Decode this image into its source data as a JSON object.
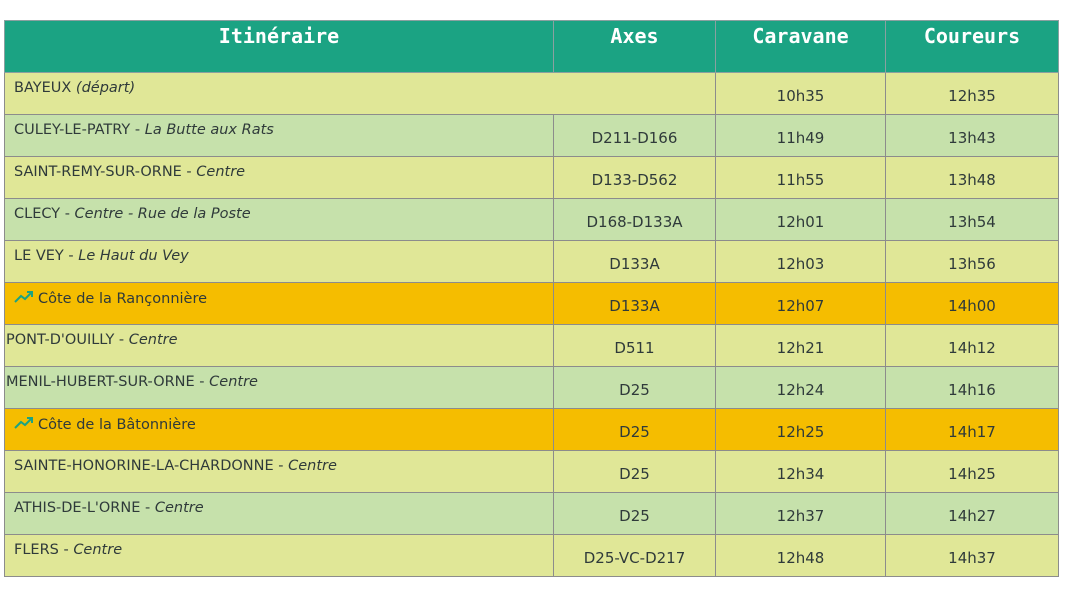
{
  "headers": {
    "itinerary": "Itinéraire",
    "axes": "Axes",
    "caravane": "Caravane",
    "coureurs": "Coureurs"
  },
  "colors": {
    "header": "#1ba383",
    "row_yellow": "#e0e797",
    "row_green": "#c6e1ab",
    "row_climb": "#f5bd00",
    "climb_icon": "#1ba383"
  },
  "rows": [
    {
      "place": "BAYEUX",
      "detail": "(départ)",
      "axes": "",
      "caravane": "10h35",
      "coureurs": "12h35",
      "style": "yellow",
      "icon": ""
    },
    {
      "place": "CULEY-LE-PATRY",
      "detail": "La Butte aux Rats",
      "axes": "D211-D166",
      "caravane": "11h49",
      "coureurs": "13h43",
      "style": "green",
      "icon": ""
    },
    {
      "place": "SAINT-REMY-SUR-ORNE",
      "detail": "Centre",
      "axes": "D133-D562",
      "caravane": "11h55",
      "coureurs": "13h48",
      "style": "yellow",
      "icon": ""
    },
    {
      "place": "CLECY",
      "detail": "Centre - Rue de la Poste",
      "axes": "D168-D133A",
      "caravane": "12h01",
      "coureurs": "13h54",
      "style": "green",
      "icon": ""
    },
    {
      "place": "LE VEY",
      "detail": "Le Haut du Vey",
      "axes": "D133A",
      "caravane": "12h03",
      "coureurs": "13h56",
      "style": "yellow",
      "icon": ""
    },
    {
      "place": "Côte de la Rançonnière",
      "detail": "",
      "axes": "D133A",
      "caravane": "12h07",
      "coureurs": "14h00",
      "style": "climb",
      "icon": "trending-up-icon"
    },
    {
      "place": "PONT-D'OUILLY",
      "detail": "Centre",
      "axes": "D511",
      "caravane": "12h21",
      "coureurs": "14h12",
      "style": "yellow",
      "icon": ""
    },
    {
      "place": "MENIL-HUBERT-SUR-ORNE",
      "detail": "Centre",
      "axes": "D25",
      "caravane": "12h24",
      "coureurs": "14h16",
      "style": "green",
      "icon": ""
    },
    {
      "place": "Côte de la Bâtonnière",
      "detail": "",
      "axes": "D25",
      "caravane": "12h25",
      "coureurs": "14h17",
      "style": "climb",
      "icon": "trending-up-icon"
    },
    {
      "place": "SAINTE-HONORINE-LA-CHARDONNE",
      "detail": "Centre",
      "axes": "D25",
      "caravane": "12h34",
      "coureurs": "14h25",
      "style": "yellow",
      "icon": ""
    },
    {
      "place": "ATHIS-DE-L'ORNE",
      "detail": "Centre",
      "axes": "D25",
      "caravane": "12h37",
      "coureurs": "14h27",
      "style": "green",
      "icon": ""
    },
    {
      "place": "FLERS",
      "detail": "Centre",
      "axes": "D25-VC-D217",
      "caravane": "12h48",
      "coureurs": "14h37",
      "style": "yellow",
      "icon": ""
    }
  ]
}
